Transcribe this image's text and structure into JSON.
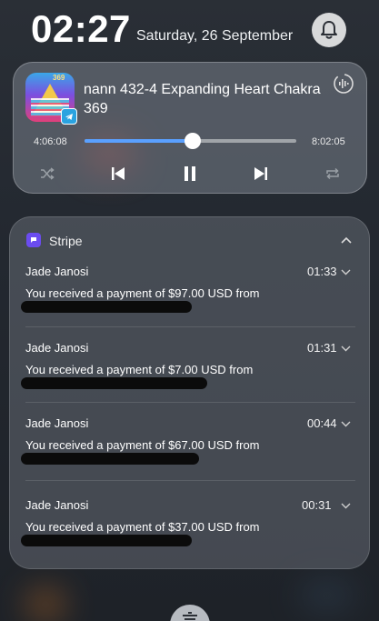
{
  "status": {
    "clock": "02:27",
    "date": "Saturday, 26 September"
  },
  "media": {
    "album_art_text": "369",
    "title": "nann 432-4 Expanding Heart Chakra 369",
    "elapsed": "4:06:08",
    "total": "8:02:05",
    "progress": 0.51,
    "source_app_icon": "telegram-icon",
    "accent_color": "#5aa0ff"
  },
  "notifications": {
    "app_name": "Stripe",
    "app_color": "#6b4cf0",
    "items": [
      {
        "sender": "Jade Janosi",
        "time": "01:33",
        "message": "You received a payment of $97.00 USD from"
      },
      {
        "sender": "Jade Janosi",
        "time": "01:31",
        "message": "You received a payment of $7.00 USD from"
      },
      {
        "sender": "Jade Janosi",
        "time": "00:44",
        "message": "You received a payment of $67.00 USD from"
      },
      {
        "sender": "Jade Janosi",
        "time": "00:31",
        "message": "You received a payment of $37.00 USD from"
      }
    ]
  },
  "icons": {
    "bell": "bell-icon",
    "sound": "sound-output-icon",
    "shuffle": "shuffle-icon",
    "previous": "skip-previous-icon",
    "pause": "pause-icon",
    "next": "skip-next-icon",
    "repeat": "repeat-icon",
    "collapse": "chevron-up-icon",
    "expand": "chevron-down-icon",
    "clear": "clear-all-icon"
  }
}
